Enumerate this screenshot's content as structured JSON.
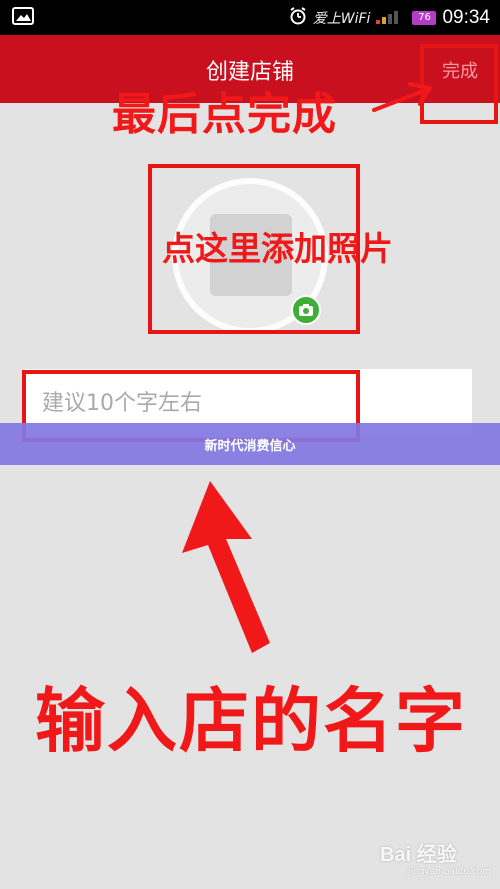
{
  "status_bar": {
    "wifi_label": "爱上WiFi",
    "battery": "76",
    "time": "09:34",
    "icons": [
      "gallery-icon",
      "alarm-clock-icon",
      "signal-icon",
      "battery-icon"
    ]
  },
  "header": {
    "title": "创建店铺",
    "done_label": "完成",
    "color": "#c8101f"
  },
  "store_name_input": {
    "placeholder": "建议10个字左右",
    "value": ""
  },
  "annotations": {
    "finish_last": "最后点完成",
    "add_photo": "点这里添加照片",
    "enter_name": "输入店的名字",
    "color": "#f01818"
  },
  "banner": {
    "text": "新时代消费信心"
  },
  "watermark": {
    "logo": "Bai 经验",
    "url": "jingyan.baidu.com"
  }
}
